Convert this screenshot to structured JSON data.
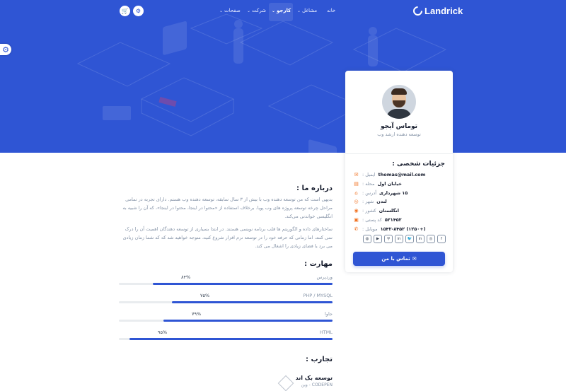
{
  "brand": {
    "name": "Landrick"
  },
  "nav": {
    "items": [
      {
        "label": "خانه",
        "chevron": false,
        "active": false
      },
      {
        "label": "مشاغل",
        "chevron": true,
        "active": false
      },
      {
        "label": "کارجو",
        "chevron": true,
        "active": true
      },
      {
        "label": "شرکت",
        "chevron": true,
        "active": false
      },
      {
        "label": "صفحات",
        "chevron": true,
        "active": false
      }
    ],
    "icons": [
      "gear-icon",
      "cart-icon"
    ]
  },
  "profile": {
    "name": "توماس آیجو",
    "role": "توسعه دهنده ارشد وب"
  },
  "personal": {
    "title": "جزئیات شخصی :",
    "rows": [
      {
        "icon": "mail-icon",
        "glyph": "✉",
        "label": "ایمیل :",
        "value": "thomas@mail.com"
      },
      {
        "icon": "bookmark-icon",
        "glyph": "▤",
        "label": "محله :",
        "value": "خیابان اول"
      },
      {
        "icon": "italic-icon",
        "glyph": "⌂",
        "label": "آدرس :",
        "value": "۱۵ شهرداری"
      },
      {
        "icon": "globe-icon",
        "glyph": "◎",
        "label": "شهر :",
        "value": "لندن"
      },
      {
        "icon": "map-pin-icon",
        "glyph": "◉",
        "label": "کشور :",
        "value": "انگلستان"
      },
      {
        "icon": "gift-icon",
        "glyph": "▣",
        "label": "کد پستی :",
        "value": "۵۲۱۴۵۲"
      },
      {
        "icon": "phone-icon",
        "glyph": "✆",
        "label": "موبایل :",
        "value": "(+۱۲۵۰) ۱۵۴۲-۸۴۵۲"
      }
    ]
  },
  "socials": [
    "f",
    "◎",
    "in",
    "🐦",
    "in",
    "⚲",
    "▶",
    "◍"
  ],
  "contact_button": "تماس با من",
  "about": {
    "title": "درباره ما :",
    "p1": "بدیهی است که من توسعه دهنده وب با بیش از ۳ سال سابقه، توسعه دهنده وب هستم. دارای تجربه در تمامی مراحل چرخه توسعه پروژه های وب پویا. برخلاف استفاده از «محتوا در اینجا، محتوا در اینجا»، که آن را شبیه به انگلیسی خواندنی می‌کند.",
    "p2": "ساختارهای داده و الگوریتم ها قلب برنامه نویسی هستند. در ابتدا بسیاری از توسعه دهندگان اهمیت آن را درک نمی کنند، اما زمانی که حرفه خود را در توسعه نرم افزار شروع کنید، متوجه خواهید شد که کد شما زمان زیادی می برد یا فضای زیادی را اشغال می کند."
  },
  "skills": {
    "title": "مهارت :",
    "items": [
      {
        "name": "وردپرس",
        "pct_label": "۸۴%",
        "value": 84
      },
      {
        "name": "PHP / MYSQL",
        "pct_label": "۷۵%",
        "value": 75
      },
      {
        "name": "جاوا",
        "pct_label": "۷۹%",
        "value": 79
      },
      {
        "name": "HTML",
        "pct_label": "۹۵%",
        "value": 95
      }
    ]
  },
  "experience": {
    "title": "تجارب :",
    "items": [
      {
        "title": "توسعه بک اند",
        "company": "CODEPEN - وین"
      }
    ]
  }
}
